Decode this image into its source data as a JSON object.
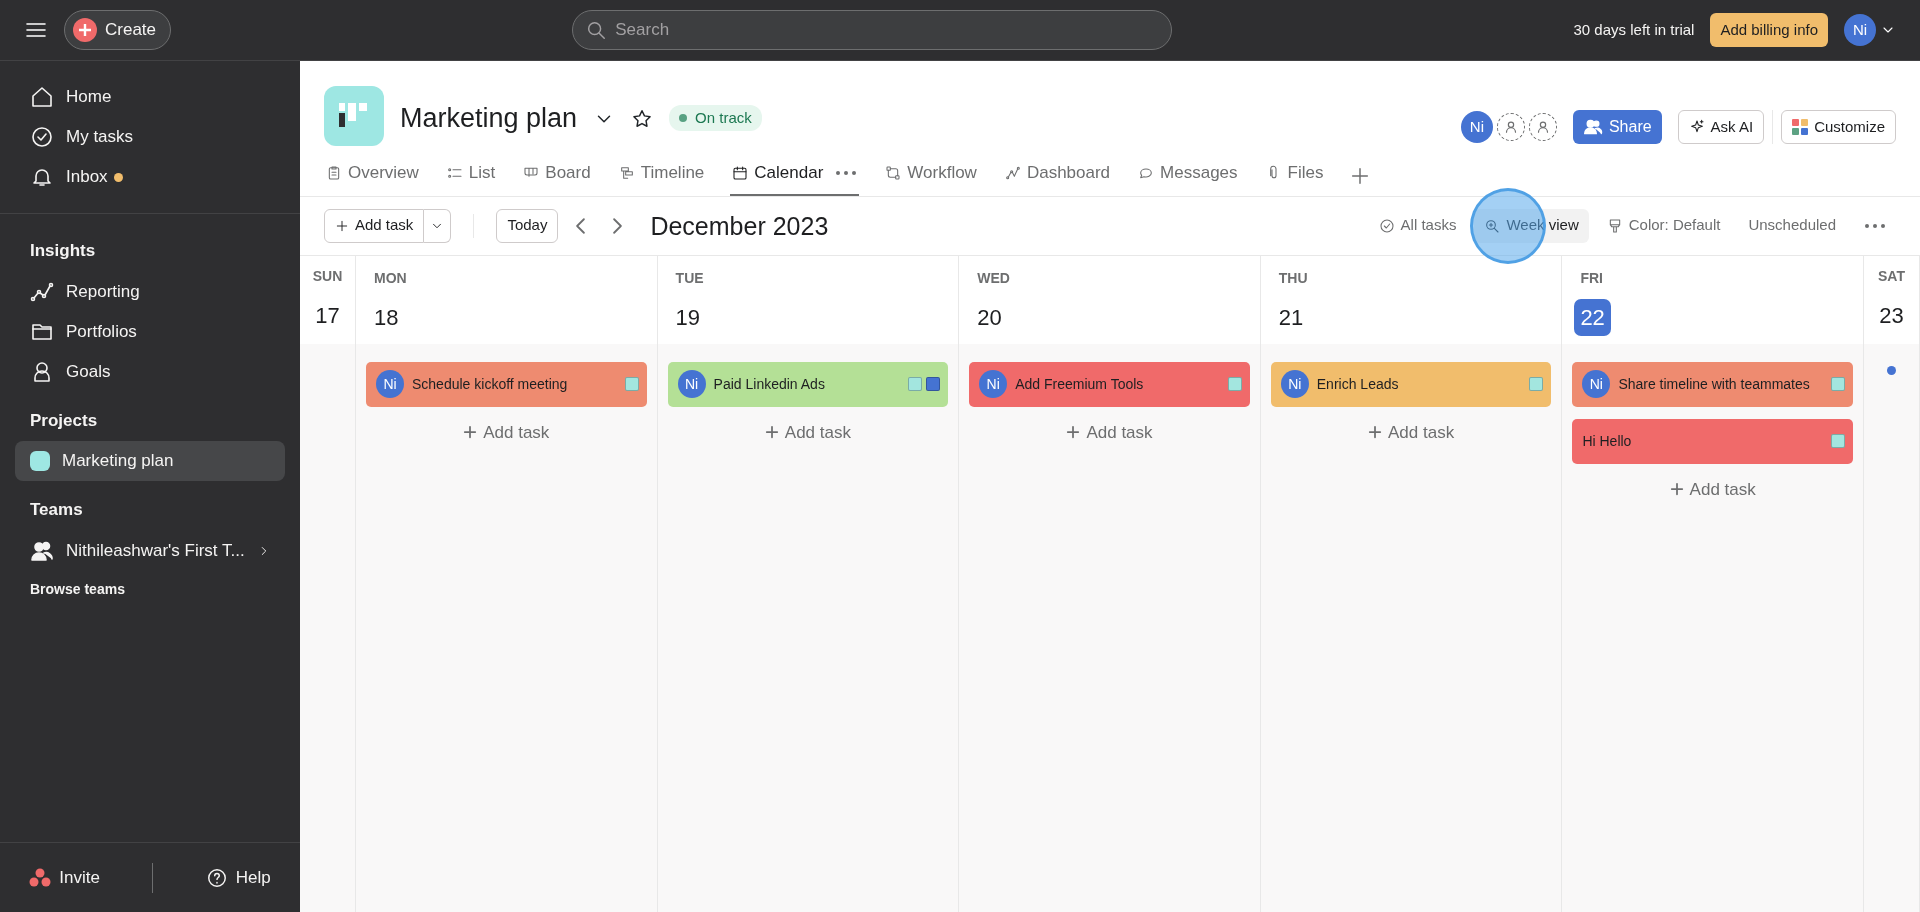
{
  "topbar": {
    "create": "Create",
    "search": {
      "placeholder": "Search"
    },
    "trial": "30 days left in trial",
    "billing": "Add billing info",
    "avatar": "Ni"
  },
  "sidebar": {
    "items": [
      {
        "label": "Home",
        "dot": false
      },
      {
        "label": "My tasks",
        "dot": false
      },
      {
        "label": "Inbox",
        "dot": true
      }
    ],
    "sections": [
      {
        "title": "Insights",
        "items": [
          {
            "label": "Reporting",
            "selected": false
          },
          {
            "label": "Portfolios",
            "selected": false
          },
          {
            "label": "Goals",
            "selected": false
          }
        ]
      },
      {
        "title": "Projects",
        "items": [
          {
            "label": "Marketing plan",
            "selected": true
          }
        ]
      },
      {
        "title": "Teams",
        "items": [
          {
            "label": "Nithileashwar's First T...",
            "selected": false
          }
        ],
        "link": "Browse teams"
      }
    ],
    "invite": "Invite",
    "help": "Help"
  },
  "project": {
    "title": "Marketing plan",
    "status": "On track",
    "members": [
      "Ni"
    ],
    "share": "Share",
    "ask_ai": "Ask AI",
    "customize": "Customize",
    "tabs": [
      {
        "label": "Overview",
        "selected": false
      },
      {
        "label": "List",
        "selected": false
      },
      {
        "label": "Board",
        "selected": false
      },
      {
        "label": "Timeline",
        "selected": false
      },
      {
        "label": "Calendar",
        "selected": true
      },
      {
        "label": "Workflow",
        "selected": false
      },
      {
        "label": "Dashboard",
        "selected": false
      },
      {
        "label": "Messages",
        "selected": false
      },
      {
        "label": "Files",
        "selected": false
      }
    ]
  },
  "toolbar": {
    "add_task": "Add task",
    "today": "Today",
    "month": "December 2023",
    "all_tasks": "All tasks",
    "week_view": "Week view",
    "color_label": "Color: Default",
    "unscheduled": "Unscheduled"
  },
  "days": [
    {
      "kind": "narrow",
      "dow": "SUN",
      "date": "17",
      "today": false,
      "more": false
    },
    {
      "kind": "full",
      "dow": "MON",
      "date": "18",
      "today": false,
      "add": "Add task",
      "tasks": [
        {
          "title": "Schedule kickoff meeting",
          "assignee": "Ni",
          "color": "#ee8b70",
          "tags": [
            {
              "color": "#a3e6df"
            }
          ]
        }
      ]
    },
    {
      "kind": "full",
      "dow": "TUE",
      "date": "19",
      "today": false,
      "add": "Add task",
      "tasks": [
        {
          "title": "Paid Linkedin Ads",
          "assignee": "Ni",
          "color": "#b4e096",
          "tags": [
            {
              "color": "#a3e6df"
            },
            {
              "color": "#4573d2"
            }
          ]
        }
      ]
    },
    {
      "kind": "full",
      "dow": "WED",
      "date": "20",
      "today": false,
      "add": "Add task",
      "tasks": [
        {
          "title": "Add Freemium Tools",
          "assignee": "Ni",
          "color": "#f06a6a",
          "tags": [
            {
              "color": "#a3e6df"
            }
          ]
        }
      ]
    },
    {
      "kind": "full",
      "dow": "THU",
      "date": "21",
      "today": false,
      "add": "Add task",
      "tasks": [
        {
          "title": "Enrich Leads",
          "assignee": "Ni",
          "color": "#f1bd6c",
          "tags": [
            {
              "color": "#a3e6df"
            }
          ]
        }
      ]
    },
    {
      "kind": "full",
      "dow": "FRI",
      "date": "22",
      "today": true,
      "add": "Add task",
      "tasks": [
        {
          "title": "Share timeline with teammates",
          "assignee": "Ni",
          "color": "#ee8b70",
          "tags": [
            {
              "color": "#a3e6df"
            }
          ]
        },
        {
          "title": "Hi Hello",
          "color": "#f06a6a",
          "tags": [
            {
              "color": "#a3e6df"
            }
          ]
        }
      ]
    },
    {
      "kind": "narrow",
      "dow": "SAT",
      "date": "23",
      "today": false,
      "more": true
    }
  ]
}
